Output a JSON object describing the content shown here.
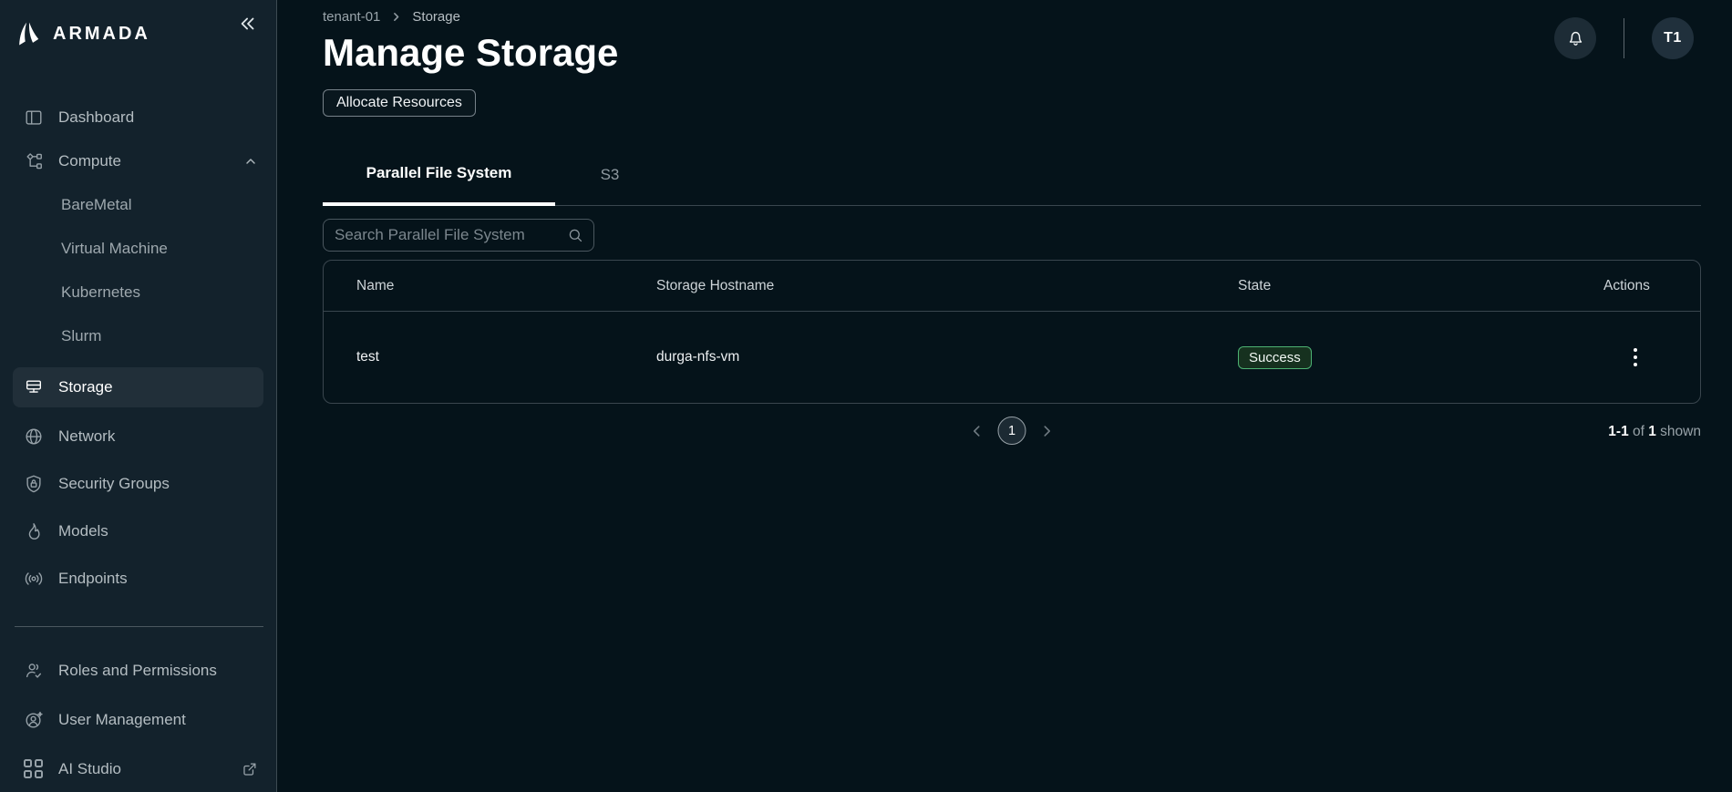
{
  "brand": {
    "name": "ARMADA"
  },
  "topbar": {
    "avatar_label": "T1"
  },
  "sidebar": {
    "items": [
      {
        "label": "Dashboard"
      },
      {
        "label": "Compute"
      },
      {
        "label": "BareMetal"
      },
      {
        "label": "Virtual Machine"
      },
      {
        "label": "Kubernetes"
      },
      {
        "label": "Slurm"
      },
      {
        "label": "Storage"
      },
      {
        "label": "Network"
      },
      {
        "label": "Security Groups"
      },
      {
        "label": "Models"
      },
      {
        "label": "Endpoints"
      },
      {
        "label": "Roles and Permissions"
      },
      {
        "label": "User Management"
      },
      {
        "label": "AI Studio"
      }
    ]
  },
  "page": {
    "breadcrumb": {
      "tenant": "tenant-01",
      "section": "Storage"
    },
    "title": "Manage Storage",
    "allocate_button_label": "Allocate Resources"
  },
  "tabs": [
    {
      "label": "Parallel File System",
      "active": true
    },
    {
      "label": "S3",
      "active": false
    }
  ],
  "search": {
    "placeholder": "Search Parallel File System"
  },
  "table": {
    "columns": [
      "Name",
      "Storage Hostname",
      "State",
      "Actions"
    ],
    "rows": [
      {
        "name": "test",
        "storage_hostname": "durga-nfs-vm",
        "state": "Success"
      }
    ]
  },
  "pagination": {
    "current_page": "1",
    "summary": {
      "range": "1-1",
      "of": " of ",
      "total": "1",
      "shown": " shown"
    }
  },
  "colors": {
    "sidebar_bg": "#13222c",
    "main_bg": "#05131a",
    "selected_item_bg": "#212f39",
    "success_border": "#4db273",
    "success_bg": "#16311f",
    "tab_active_indicator": "#ffffff"
  },
  "icons": {
    "logo": "sail-logo-icon",
    "collapse": "chevrons-left-icon",
    "dashboard": "layout-panel-icon",
    "compute": "workflow-nodes-icon",
    "compute_state": "chevron-up-icon",
    "storage": "server-icon",
    "network": "globe-icon",
    "security_groups": "shield-lock-icon",
    "models": "flame-icon",
    "endpoints": "broadcast-icon",
    "roles": "users-check-icon",
    "user_management": "user-badge-icon",
    "ai_studio": "color-grid-icon",
    "external_link": "external-link-icon",
    "notifications": "bell-icon",
    "search": "magnifier-icon",
    "row_actions": "kebab-menu-icon",
    "breadcrumb_separator": "chevron-right-icon",
    "pagination_prev": "chevron-left-icon",
    "pagination_next": "chevron-right-icon"
  }
}
